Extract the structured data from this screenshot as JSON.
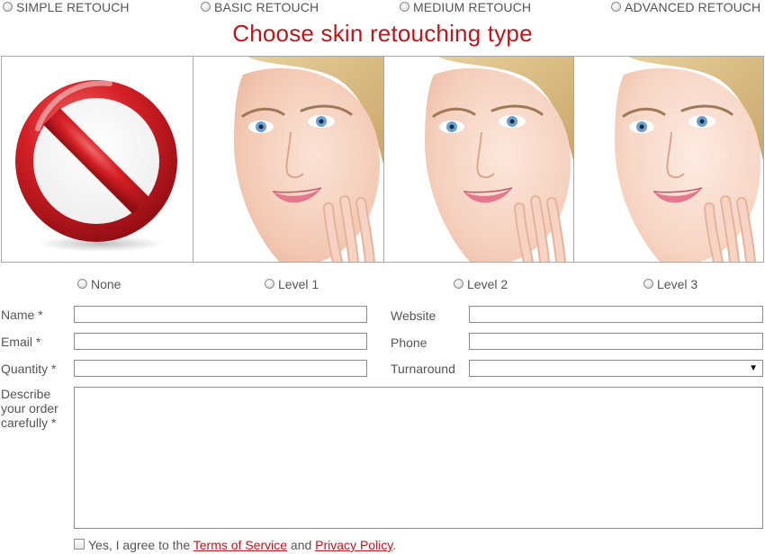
{
  "retouch_types": [
    {
      "label": "SIMPLE RETOUCH"
    },
    {
      "label": "BASIC RETOUCH"
    },
    {
      "label": "MEDIUM RETOUCH"
    },
    {
      "label": "ADVANCED RETOUCH"
    }
  ],
  "title": "Choose skin retouching type",
  "levels": [
    {
      "label": "None"
    },
    {
      "label": "Level 1"
    },
    {
      "label": "Level 2"
    },
    {
      "label": "Level 3"
    }
  ],
  "form": {
    "name_label": "Name *",
    "email_label": "Email *",
    "quantity_label": "Quantity *",
    "website_label": "Website",
    "phone_label": "Phone",
    "turnaround_label": "Turnaround",
    "describe_label_line1": "Describe",
    "describe_label_line2": "your order",
    "describe_label_line3": "carefully *"
  },
  "agreement": {
    "prefix": "Yes, I agree to the",
    "terms_link": "Terms of Service",
    "middle": "and",
    "privacy_link": "Privacy Policy",
    "suffix": "."
  },
  "colors": {
    "accent": "#c0161b",
    "text": "#555555",
    "border": "#8a8a8a"
  },
  "icons": {
    "none_image": "prohibited-sign-icon",
    "face_image": "woman-face-photo"
  }
}
